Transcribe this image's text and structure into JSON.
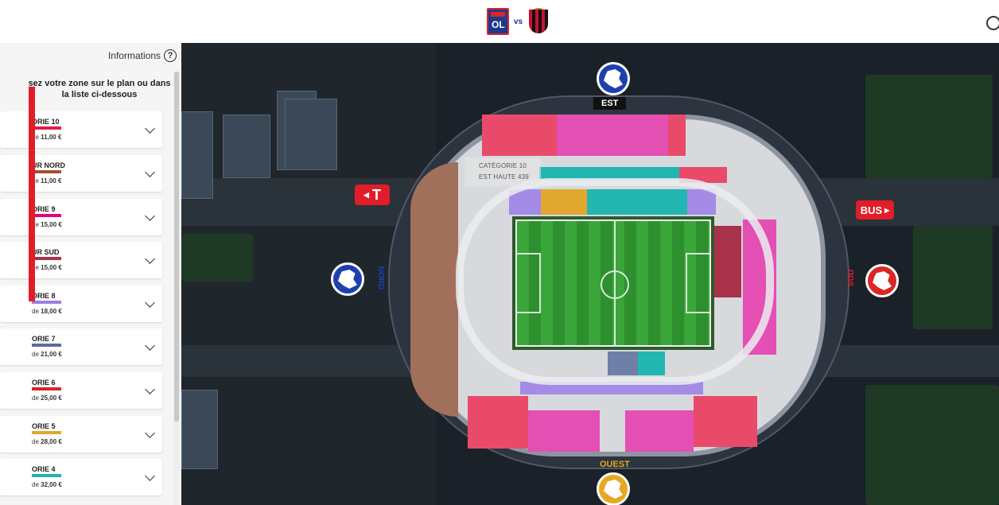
{
  "header": {
    "vs": "vs",
    "home_team_icon": "olympique-lyonnais-crest",
    "away_team_icon": "ogc-nice-crest",
    "user_icon": "account-icon"
  },
  "sidebar": {
    "info_label": "Informations",
    "instructions": "sez votre zone sur le plan ou dans la liste ci-dessous",
    "categories": [
      {
        "name": "ORIE 10",
        "price_prefix": "de",
        "price": "11,00 €",
        "color": "#e11d48"
      },
      {
        "name": "UR NORD",
        "price_prefix": "de",
        "price": "11,00 €",
        "color": "#a0522d"
      },
      {
        "name": "ORIE 9",
        "price_prefix": "de",
        "price": "15,00 €",
        "color": "#e4007c"
      },
      {
        "name": "UR SUD",
        "price_prefix": "de",
        "price": "15,00 €",
        "color": "#a8324a"
      },
      {
        "name": "ORIE 8",
        "price_prefix": "de",
        "price": "18,00 €",
        "color": "#9d7fe0"
      },
      {
        "name": "ORIE 7",
        "price_prefix": "de",
        "price": "21,00 €",
        "color": "#5b6e9a"
      },
      {
        "name": "ORIE 6",
        "price_prefix": "de",
        "price": "25,00 €",
        "color": "#d9232e"
      },
      {
        "name": "ORIE 5",
        "price_prefix": "de",
        "price": "28,00 €",
        "color": "#e0a82e"
      },
      {
        "name": "ORIE 4",
        "price_prefix": "de",
        "price": "32,00 €",
        "color": "#1fb5ad"
      }
    ]
  },
  "map": {
    "tooltip_category": "CATÉGORIE 10",
    "tooltip_zone": "EST HAUTE 439",
    "stand_est": "EST",
    "stand_ouest": "OUEST",
    "stand_nord": "NORD",
    "stand_sud": "SUD",
    "tram_sign": "T",
    "bus_sign": "BUS"
  }
}
